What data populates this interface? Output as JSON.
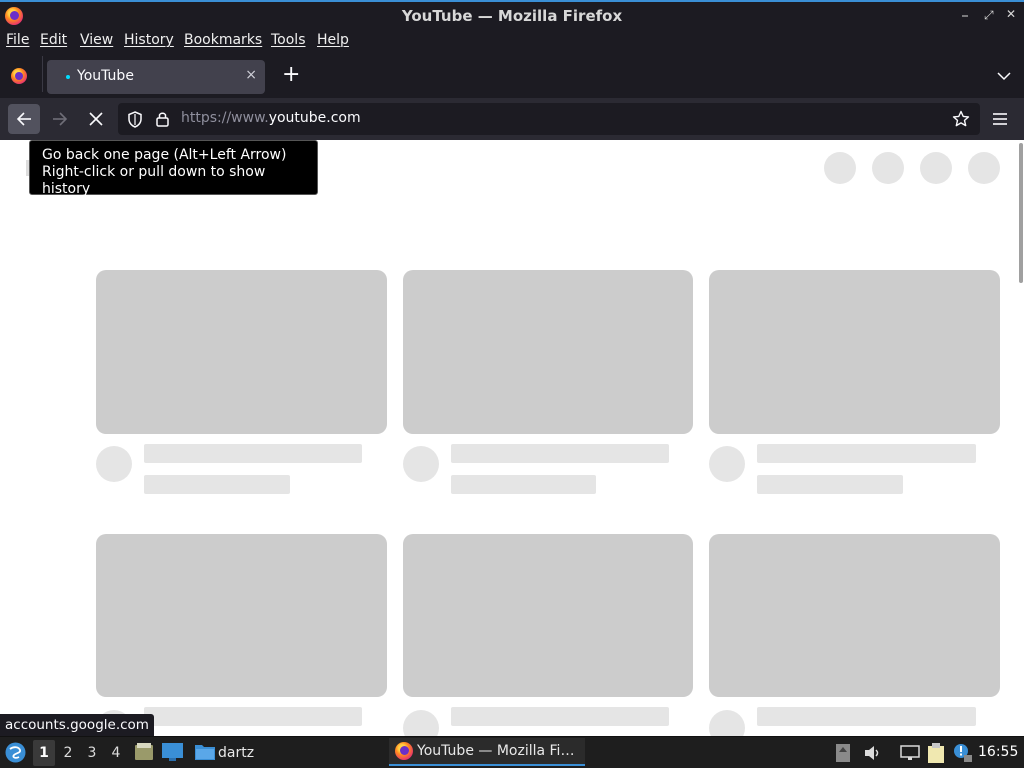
{
  "window": {
    "title": "YouTube — Mozilla Firefox"
  },
  "menu": {
    "file": "File",
    "edit": "Edit",
    "view": "View",
    "history": "History",
    "bookmarks": "Bookmarks",
    "tools": "Tools",
    "help": "Help"
  },
  "tab": {
    "title": "YouTube",
    "close": "×",
    "new_tab": "+"
  },
  "urlbar": {
    "scheme": "https://www.",
    "host": "youtube.com"
  },
  "tooltip": {
    "line1": "Go back one page (Alt+Left Arrow)",
    "line2": "Right-click or pull down to show history"
  },
  "status": {
    "text": "accounts.google.com"
  },
  "taskbar": {
    "workspaces": [
      "1",
      "2",
      "3",
      "4"
    ],
    "folder_label": "dartz",
    "window_label": "YouTube — Mozilla Fi…",
    "clock": "16:55"
  },
  "colors": {
    "accent": "#3a8fd6",
    "skeleton": "#e5e5e5",
    "thumb": "#cccccc"
  }
}
